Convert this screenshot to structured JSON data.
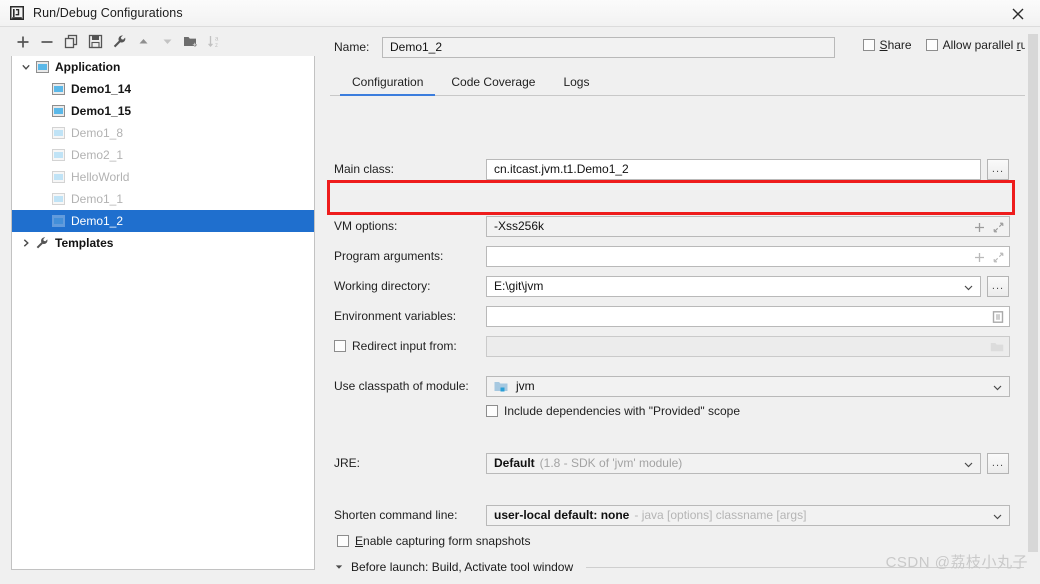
{
  "window": {
    "title": "Run/Debug Configurations",
    "app_icon": "intellij-idea-icon",
    "close_icon": "close-icon"
  },
  "toolbar": {
    "buttons": [
      {
        "name": "add-configuration-button",
        "icon": "plus-icon",
        "label": "+",
        "disabled": false
      },
      {
        "name": "remove-configuration-button",
        "icon": "minus-icon",
        "label": "−",
        "disabled": false
      },
      {
        "name": "copy-configuration-button",
        "icon": "copy-icon",
        "label": "Copy",
        "disabled": false
      },
      {
        "name": "save-configuration-button",
        "icon": "save-icon",
        "label": "Save",
        "disabled": false
      },
      {
        "name": "edit-templates-button",
        "icon": "wrench-icon",
        "label": "Edit Templates",
        "disabled": false
      },
      {
        "name": "move-up-button",
        "icon": "arrow-up-icon",
        "label": "Move Up",
        "disabled": false
      },
      {
        "name": "move-down-button",
        "icon": "arrow-down-icon",
        "label": "Move Down",
        "disabled": true
      },
      {
        "name": "new-folder-button",
        "icon": "folder-plus-icon",
        "label": "New Folder",
        "disabled": false
      },
      {
        "name": "sort-configurations-button",
        "icon": "sort-az-icon",
        "label": "Sort Configurations",
        "disabled": true
      }
    ]
  },
  "tree": {
    "groups": [
      {
        "label": "Application",
        "icon": "application-icon",
        "expanded": true,
        "twisty": "chevron-down-icon",
        "children": [
          {
            "label": "Demo1_14",
            "icon": "application-icon",
            "state": "enabled",
            "selected": false
          },
          {
            "label": "Demo1_15",
            "icon": "application-icon",
            "state": "enabled",
            "selected": false
          },
          {
            "label": "Demo1_8",
            "icon": "application-icon",
            "state": "dim",
            "selected": false
          },
          {
            "label": "Demo2_1",
            "icon": "application-icon",
            "state": "dim",
            "selected": false
          },
          {
            "label": "HelloWorld",
            "icon": "application-icon",
            "state": "dim",
            "selected": false
          },
          {
            "label": "Demo1_1",
            "icon": "application-icon",
            "state": "dim",
            "selected": false
          },
          {
            "label": "Demo1_2",
            "icon": "application-icon",
            "state": "dim",
            "selected": true
          }
        ]
      }
    ],
    "templates": {
      "label": "Templates",
      "icon": "wrench-icon",
      "twisty": "chevron-right-icon",
      "expanded": false
    }
  },
  "header": {
    "name_label": "Name:",
    "name_value": "Demo1_2",
    "share_label": "Share",
    "share_checked": false,
    "allow_parallel_label": "Allow parallel run",
    "allow_parallel_checked": false
  },
  "tabs": [
    {
      "label": "Configuration",
      "active": true
    },
    {
      "label": "Code Coverage",
      "active": false
    },
    {
      "label": "Logs",
      "active": false
    }
  ],
  "form": {
    "main_class": {
      "label": "Main class:",
      "value": "cn.itcast.jvm.t1.Demo1_2",
      "browse_label": "..."
    },
    "vm_options": {
      "label": "VM options:",
      "value": "-Xss256k",
      "expand_icon": "expand-diagonal-icon",
      "insert_icon": "plus-icon",
      "highlighted": true
    },
    "program_arguments": {
      "label": "Program arguments:",
      "value": "",
      "expand_icon": "expand-diagonal-icon",
      "insert_icon": "plus-icon"
    },
    "working_directory": {
      "label": "Working directory:",
      "value": "E:\\git\\jvm",
      "browse_label": "...",
      "dropdown_icon": "chevron-down-icon"
    },
    "environment_variables": {
      "label": "Environment variables:",
      "value": "",
      "trailing_icon": "browse-env-icon"
    },
    "redirect_input": {
      "label": "Redirect input from:",
      "checked": false,
      "value": "",
      "trailing_icon": "folder-icon"
    },
    "use_classpath": {
      "label": "Use classpath of module:",
      "value": "jvm",
      "module_icon": "module-icon",
      "dropdown_icon": "chevron-down-icon"
    },
    "include_provided": {
      "label": "Include dependencies with \"Provided\" scope",
      "checked": false
    },
    "jre": {
      "label": "JRE:",
      "value": "Default",
      "hint": "(1.8 - SDK of 'jvm' module)",
      "browse_label": "...",
      "dropdown_icon": "chevron-down-icon"
    },
    "shorten_command_line": {
      "label": "Shorten command line:",
      "value": "user-local default: none",
      "hint": "- java [options] classname [args]",
      "dropdown_icon": "chevron-down-icon"
    },
    "enable_capturing": {
      "label": "Enable capturing form snapshots",
      "underlined_char": "E",
      "checked": false
    }
  },
  "before_launch": {
    "arrow_icon": "chevron-down-icon",
    "text": "Before launch: Build, Activate tool window"
  },
  "watermark": "CSDN @荔枝小丸子",
  "colors": {
    "accent": "#3b7ddd",
    "selection": "#1f6fce",
    "annotation": "#ee1c1c",
    "window_bg": "#f0f0f0"
  }
}
